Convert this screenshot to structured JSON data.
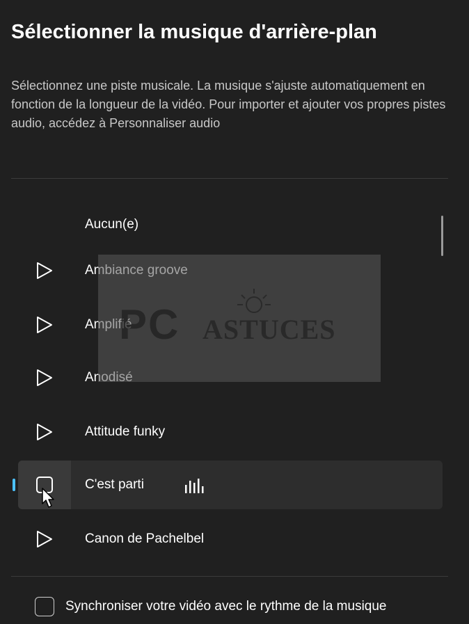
{
  "dialog": {
    "title": "Sélectionner la musique d'arrière-plan",
    "description": "Sélectionnez une piste musicale. La musique s'ajuste automatiquement en fonction de la longueur de la vidéo. Pour importer et ajouter vos propres pistes audio, accédez à Personnaliser audio"
  },
  "tracks": [
    {
      "label": "Aucun(e)",
      "icon": "none",
      "selected": false
    },
    {
      "label": "Ambiance groove",
      "icon": "play-icon",
      "selected": false
    },
    {
      "label": "Amplifié",
      "icon": "play-icon",
      "selected": false
    },
    {
      "label": "Anodisé",
      "icon": "play-icon",
      "selected": false
    },
    {
      "label": "Attitude funky",
      "icon": "play-icon",
      "selected": false
    },
    {
      "label": "C'est parti",
      "icon": "stop-icon",
      "selected": true,
      "playing": true
    },
    {
      "label": "Canon de Pachelbel",
      "icon": "play-icon",
      "selected": false
    }
  ],
  "sync": {
    "label": "Synchroniser votre vidéo avec le rythme de la musique",
    "checked": false
  },
  "watermark": {
    "text_pc": "PC",
    "text_astuces": "ASTUCES"
  },
  "colors": {
    "background": "#202020",
    "selected_row": "#2d2d2d",
    "accent": "#4cc2ff",
    "divider": "#3c3c3c",
    "secondary_text": "#c8c8c8"
  }
}
